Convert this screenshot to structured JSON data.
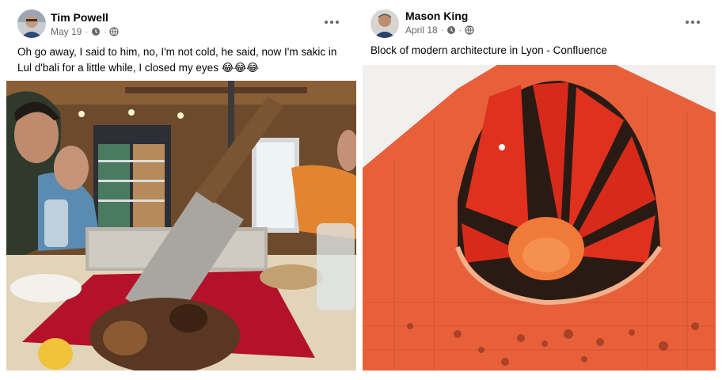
{
  "posts": [
    {
      "author": "Tim Powell",
      "date": "May 19",
      "separator": "·",
      "text_line1": "Oh go away, I said to him, no, I'm not cold, he said, now I'm sakic in",
      "text_line2": "Lul d'bali for a little while, I closed my eyes 😂😂😂",
      "privacy_icon": "globe-icon",
      "more_icon": "more-options-icon"
    },
    {
      "author": "Mason King",
      "date": "April 18",
      "separator": "·",
      "text_line1": "Block of modern architecture in Lyon - Confluence",
      "privacy_icon": "globe-icon",
      "more_icon": "more-options-icon"
    }
  ],
  "colors": {
    "author_text": "#050505",
    "meta_text": "#65676b",
    "building_orange": "#e8603a",
    "red_runner": "#c0182a"
  }
}
